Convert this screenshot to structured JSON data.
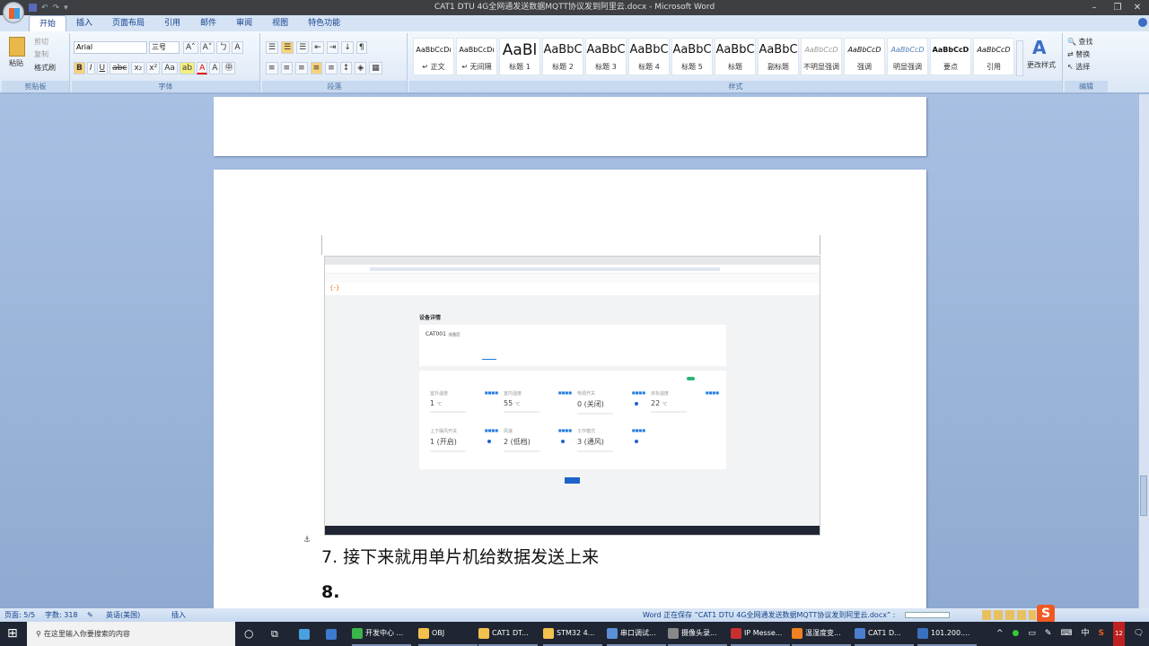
{
  "window": {
    "title": "CAT1  DTU 4G全网通发送数据MQTT协议发到阿里云.docx - Microsoft Word",
    "minimize": "–",
    "maximize": "❐",
    "close": "✕"
  },
  "tabs": [
    "开始",
    "插入",
    "页面布局",
    "引用",
    "邮件",
    "审阅",
    "视图",
    "特色功能"
  ],
  "clipboard": {
    "paste": "粘贴",
    "cut": "剪切",
    "copy": "复制",
    "format_painter": "格式刷",
    "label": "剪贴板"
  },
  "font": {
    "name": "Arial",
    "size": "三号",
    "label": "字体",
    "bold": "B",
    "italic": "I",
    "underline": "U",
    "strike": "abc",
    "sub": "x₂",
    "sup": "x²",
    "case": "Aa",
    "grow": "A˄",
    "shrink": "A˅",
    "clear": "A"
  },
  "paragraph": {
    "label": "段落"
  },
  "styles": {
    "label": "样式",
    "items": [
      {
        "sample": "AaBbCcDı",
        "name": "↵ 正文"
      },
      {
        "sample": "AaBbCcDı",
        "name": "↵ 无间隔"
      },
      {
        "sample": "AaBl",
        "name": "标题 1"
      },
      {
        "sample": "AaBbC",
        "name": "标题 2"
      },
      {
        "sample": "AaBbC",
        "name": "标题 3"
      },
      {
        "sample": "AaBbC",
        "name": "标题 4"
      },
      {
        "sample": "AaBbC",
        "name": "标题 5"
      },
      {
        "sample": "AaBbC",
        "name": "标题"
      },
      {
        "sample": "AaBbC",
        "name": "副标题"
      },
      {
        "sample": "AaBbCcD",
        "name": "不明显强调"
      },
      {
        "sample": "AaBbCcD",
        "name": "强调"
      },
      {
        "sample": "AaBbCcD",
        "name": "明显强调"
      },
      {
        "sample": "AaBbCcD",
        "name": "要点"
      },
      {
        "sample": "AaBbCcD",
        "name": "引用"
      }
    ],
    "change": "更改样式"
  },
  "editing": {
    "find": "查找",
    "replace": "替换",
    "select": "选择",
    "label": "编辑"
  },
  "document": {
    "line7": "7. 接下来就用单片机给数据发送上来",
    "line8": "8."
  },
  "embedded": {
    "brand": "{-}",
    "crumb_title": "设备详情",
    "device": "CAT001",
    "status": "未激活",
    "props": [
      {
        "label": "室外温度",
        "value": "1",
        "unit": "℃"
      },
      {
        "label": "室内温度",
        "value": "55",
        "unit": "℃"
      },
      {
        "label": "电源开关",
        "value": "0 (关闭)"
      },
      {
        "label": "目标温度",
        "value": "22",
        "unit": "℃"
      },
      {
        "label": "上下摆风开关",
        "value": "1 (开启)"
      },
      {
        "label": "风速",
        "value": "2 (低档)"
      },
      {
        "label": "工作模式",
        "value": "3 (通风)"
      }
    ]
  },
  "status": {
    "page": "页面: 5/5",
    "words": "字数: 318",
    "lang": "英语(美国)",
    "mode": "插入",
    "saving": "Word 正在保存 “CAT1  DTU 4G全网通发送数据MQTT协议发到阿里云.docx” :"
  },
  "taskbar": {
    "search_placeholder": "在这里输入你要搜索的内容",
    "apps": [
      {
        "label": "开发中心 ...",
        "color": "#3ab54a"
      },
      {
        "label": "OBJ",
        "color": "#f2c14e"
      },
      {
        "label": "CAT1 DT...",
        "color": "#f2c14e"
      },
      {
        "label": "STM32 4...",
        "color": "#f2c14e"
      },
      {
        "label": "串口调试...",
        "color": "#5b8fd8"
      },
      {
        "label": "摄像头录...",
        "color": "#888"
      },
      {
        "label": "IP Messe...",
        "color": "#c83030"
      },
      {
        "label": "温湿度变...",
        "color": "#f08020"
      },
      {
        "label": "CAT1  D...",
        "color": "#4a7fd0"
      },
      {
        "label": "101.200....",
        "color": "#3a70c0"
      }
    ],
    "ime": "中",
    "notif": "12"
  }
}
